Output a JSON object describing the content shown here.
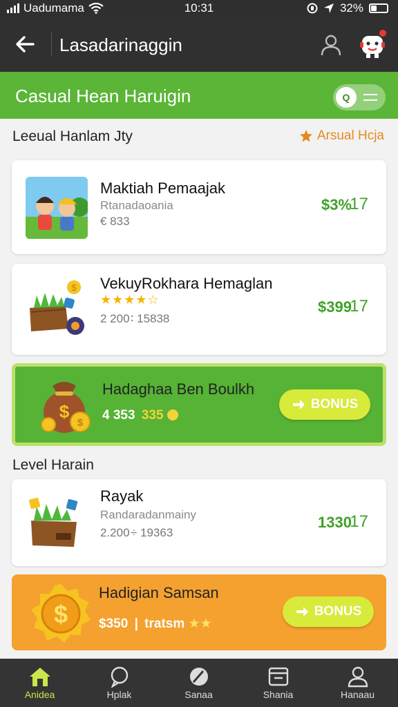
{
  "status_bar": {
    "carrier": "Uadumama",
    "time": "10:31",
    "battery": "32%"
  },
  "app_bar": {
    "title": "Lasadarinaggin"
  },
  "green_header": {
    "title": "Casual Hean Haruigin",
    "toggle_label": "Q"
  },
  "section1": {
    "title": "Leeual Hanlam Jty",
    "link": "Arsual Hcja"
  },
  "items": [
    {
      "name": "Maktiah Pemaajak",
      "sub": "Rtanadaoania",
      "meta": "€ 833",
      "price": "$3%",
      "count": "17"
    },
    {
      "name": "VekuyRokhara Hemaglan",
      "stars": "★★★★☆",
      "meta": "2 200 ∶ 15838",
      "price": "$399",
      "count": "17"
    }
  ],
  "bonus_banner": {
    "title": "Hadaghaa Ben Boulkh",
    "amount": "4 353",
    "amount_highlight": "335",
    "button_label": "BONUS"
  },
  "section2": {
    "title": "Level Harain"
  },
  "item3": {
    "name": "Rayak",
    "sub": "Randaradanmainy",
    "meta": "2.200 ÷ 19363",
    "price": "1330",
    "count": "17"
  },
  "orange_banner": {
    "title": "Hadigian Samsan",
    "amount": "$350",
    "amount_text": "tratsm",
    "button_label": "BONUS"
  },
  "bottom_nav": [
    {
      "label": "Anidea",
      "icon": "home-icon"
    },
    {
      "label": "Hplak",
      "icon": "chat-icon"
    },
    {
      "label": "Sanaa",
      "icon": "compass-icon"
    },
    {
      "label": "Shania",
      "icon": "calendar-icon"
    },
    {
      "label": "Hanaau",
      "icon": "profile-icon"
    }
  ],
  "colors": {
    "green": "#5bb537",
    "dark_bar": "#303030",
    "orange": "#f4a12f",
    "bonus_button": "#d8ea3a",
    "nav_active": "#c9e64b"
  }
}
